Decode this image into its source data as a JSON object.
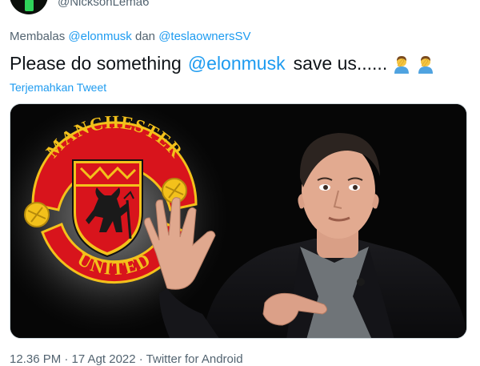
{
  "author": {
    "handle": "@NicksonLema6"
  },
  "reply": {
    "prefix": "Membalas",
    "mention1": "@elonmusk",
    "conjunction": "dan",
    "mention2": "@teslaownersSV"
  },
  "tweet": {
    "text_before": "Please do something",
    "mention": "@elonmusk",
    "text_after": "save us......",
    "emojis": [
      "person-facepalming-emoji",
      "person-facepalming-emoji"
    ]
  },
  "translate_label": "Terjemahkan Tweet",
  "media": {
    "crest_top_text": "MANCHESTER",
    "crest_bottom_text": "UNITED"
  },
  "footer": {
    "meta": "12.36 PM · 17 Agt 2022 · Twitter for Android"
  }
}
